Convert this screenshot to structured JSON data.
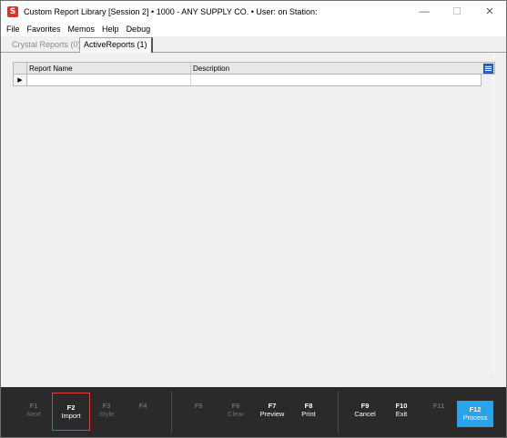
{
  "window": {
    "title": "Custom Report Library [Session 2]  •  1000 - ANY SUPPLY CO.  •  User:              on Station:",
    "app_icon_letter": "S",
    "minimize": "—",
    "maximize": "☐",
    "close": "✕"
  },
  "menu": [
    "File",
    "Favorites",
    "Memos",
    "Help",
    "Debug"
  ],
  "tabs": [
    {
      "label": "Crystal Reports (0)",
      "state": "inactive"
    },
    {
      "label": "ActiveReports (1)",
      "state": "active"
    }
  ],
  "grid": {
    "columns": [
      "Report Name",
      "Description"
    ],
    "rows": [
      {
        "report_name": "",
        "description": ""
      }
    ],
    "current_row_marker": "▶"
  },
  "function_keys": [
    {
      "key": "F1",
      "label": "Next",
      "enabled": false
    },
    {
      "key": "F2",
      "label": "Import",
      "enabled": true,
      "highlighted": true
    },
    {
      "key": "F3",
      "label": "Style",
      "enabled": false
    },
    {
      "key": "F4",
      "label": "",
      "enabled": false
    },
    {
      "key": "F5",
      "label": "",
      "enabled": false
    },
    {
      "key": "F6",
      "label": "Clear",
      "enabled": false
    },
    {
      "key": "F7",
      "label": "Preview",
      "enabled": true
    },
    {
      "key": "F8",
      "label": "Print",
      "enabled": true
    },
    {
      "key": "F9",
      "label": "Cancel",
      "enabled": true
    },
    {
      "key": "F10",
      "label": "Exit",
      "enabled": true
    },
    {
      "key": "F11",
      "label": "",
      "enabled": false
    },
    {
      "key": "F12",
      "label": "Process",
      "enabled": true,
      "primary": true
    }
  ],
  "colors": {
    "fkey_bar": "#2a2a2a",
    "primary_button": "#29a3ea",
    "highlight_box": "#e0403a",
    "app_icon": "#d8332a"
  }
}
